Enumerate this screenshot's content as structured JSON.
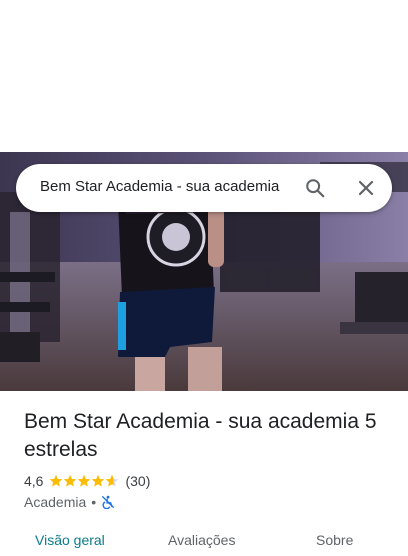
{
  "search": {
    "query": "Bem Star Academia - sua academia",
    "search_icon": "search-icon",
    "close_icon": "close-icon"
  },
  "place": {
    "title": "Bem Star Academia - sua academia 5 estrelas",
    "rating": "4,6",
    "stars": 4.6,
    "review_count": "(30)",
    "category": "Academia",
    "separator": "•",
    "accessibility_icon": "not-accessible-icon"
  },
  "tabs": [
    {
      "label": "Visão geral",
      "active": true
    },
    {
      "label": "Avaliações",
      "active": false
    },
    {
      "label": "Sobre",
      "active": false
    }
  ],
  "colors": {
    "star": "#fbbc04",
    "active_tab": "#0b7b8a",
    "access_icon": "#1a73e8"
  }
}
